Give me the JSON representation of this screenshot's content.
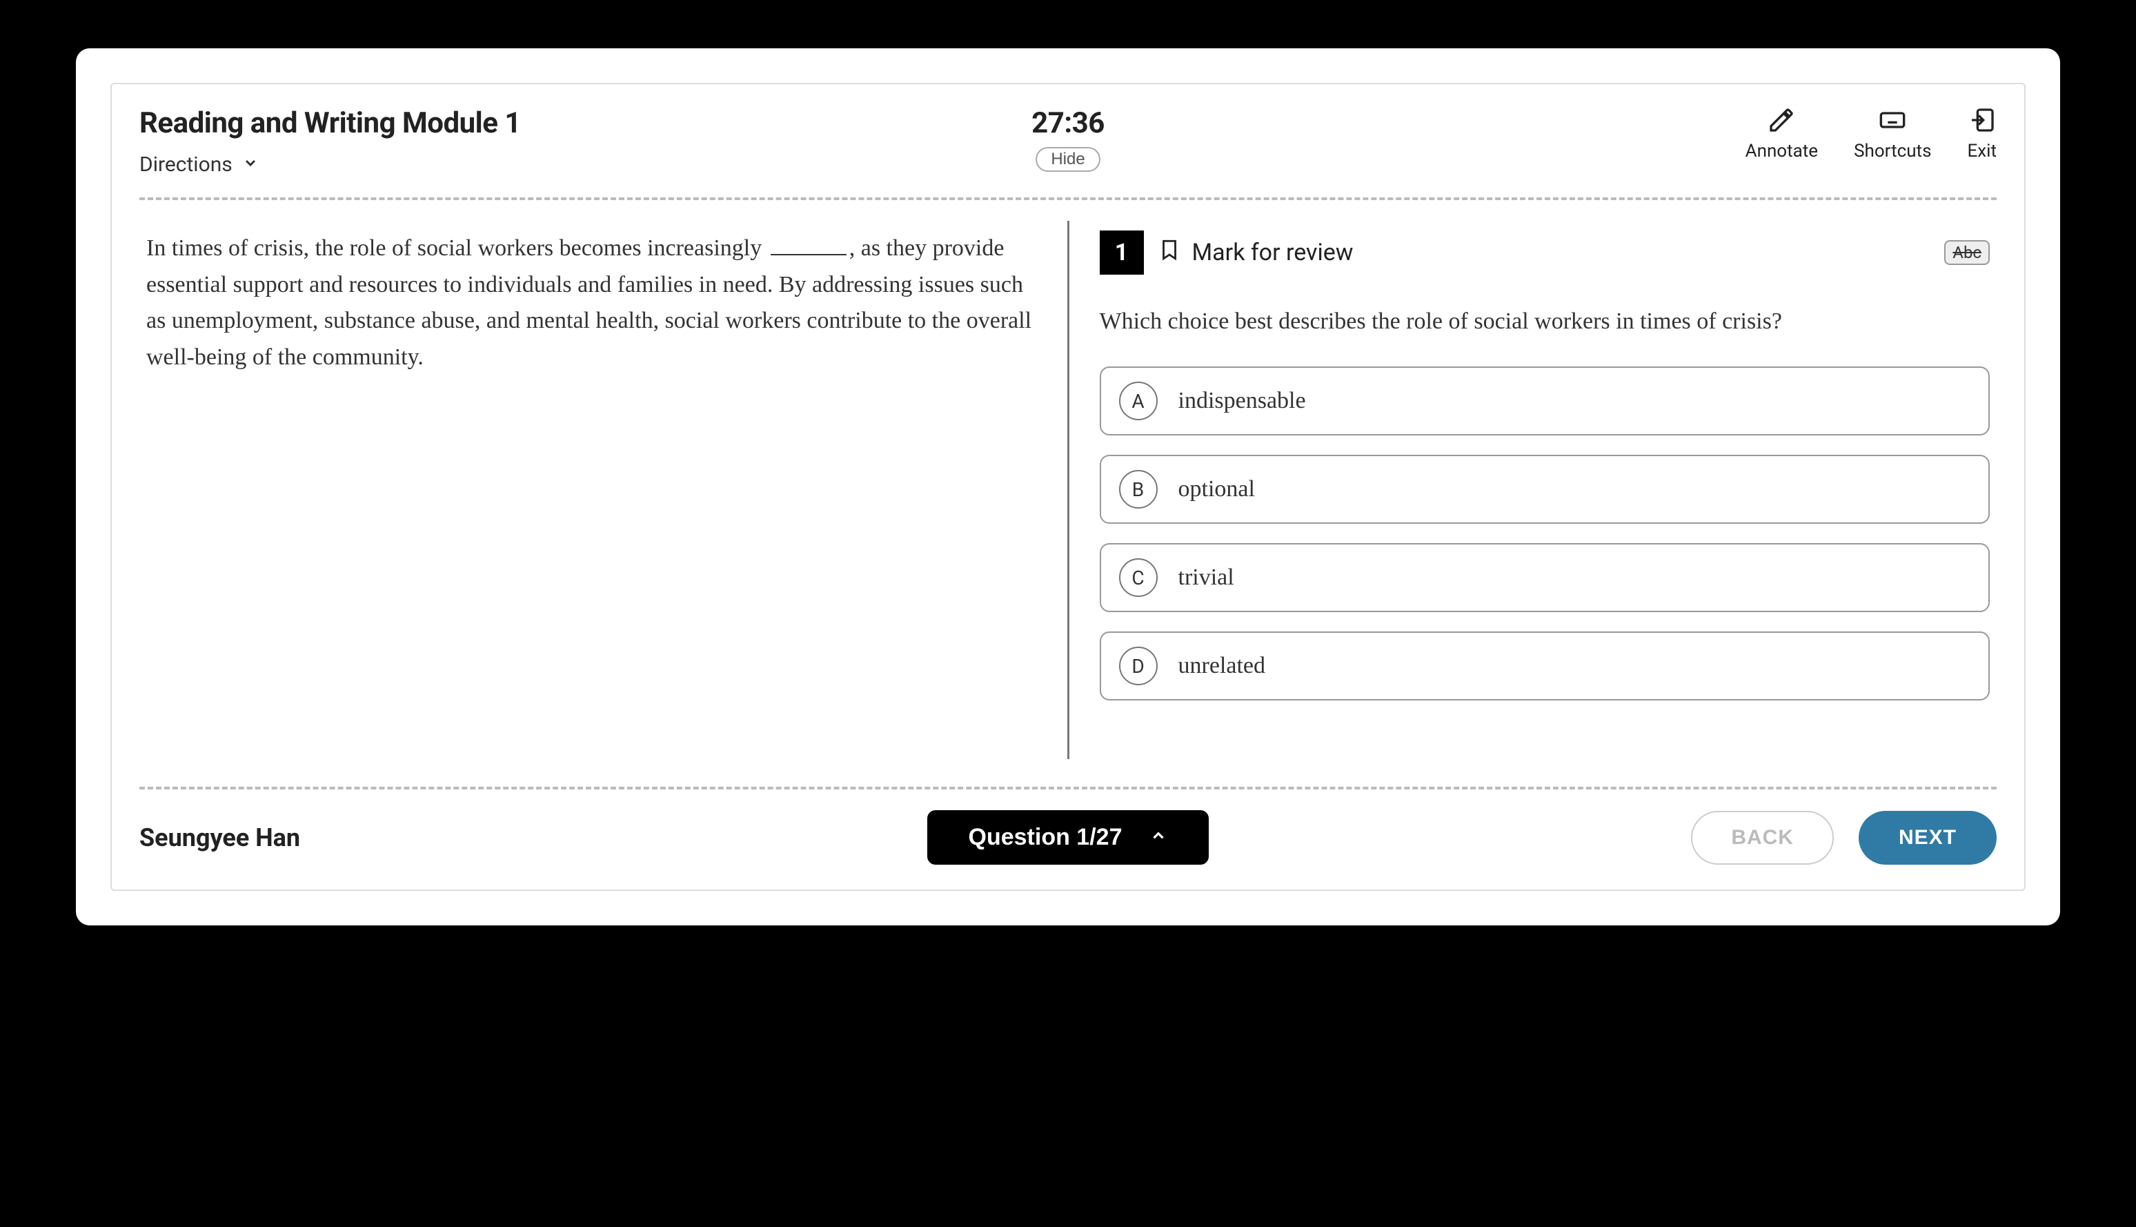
{
  "header": {
    "module_title": "Reading and Writing Module 1",
    "directions_label": "Directions",
    "timer": "27:36",
    "hide_label": "Hide",
    "tools": {
      "annotate": "Annotate",
      "shortcuts": "Shortcuts",
      "exit": "Exit"
    }
  },
  "passage": {
    "pre_blank": "In times of crisis, the role of social workers becomes increasingly ",
    "post_blank": ", as they provide essential support and resources to individuals and families in need. By addressing issues such as unemployment, substance abuse, and mental health, social workers contribute to the overall well-being of the community."
  },
  "question": {
    "number": "1",
    "mark_label": "Mark for review",
    "abc_label": "Abc",
    "prompt": "Which choice best describes the role of social workers in times of crisis?",
    "choices": [
      {
        "letter": "A",
        "text": "indispensable"
      },
      {
        "letter": "B",
        "text": "optional"
      },
      {
        "letter": "C",
        "text": "trivial"
      },
      {
        "letter": "D",
        "text": "unrelated"
      }
    ]
  },
  "footer": {
    "student_name": "Seungyee Han",
    "indicator": "Question 1/27",
    "back_label": "BACK",
    "next_label": "NEXT"
  }
}
